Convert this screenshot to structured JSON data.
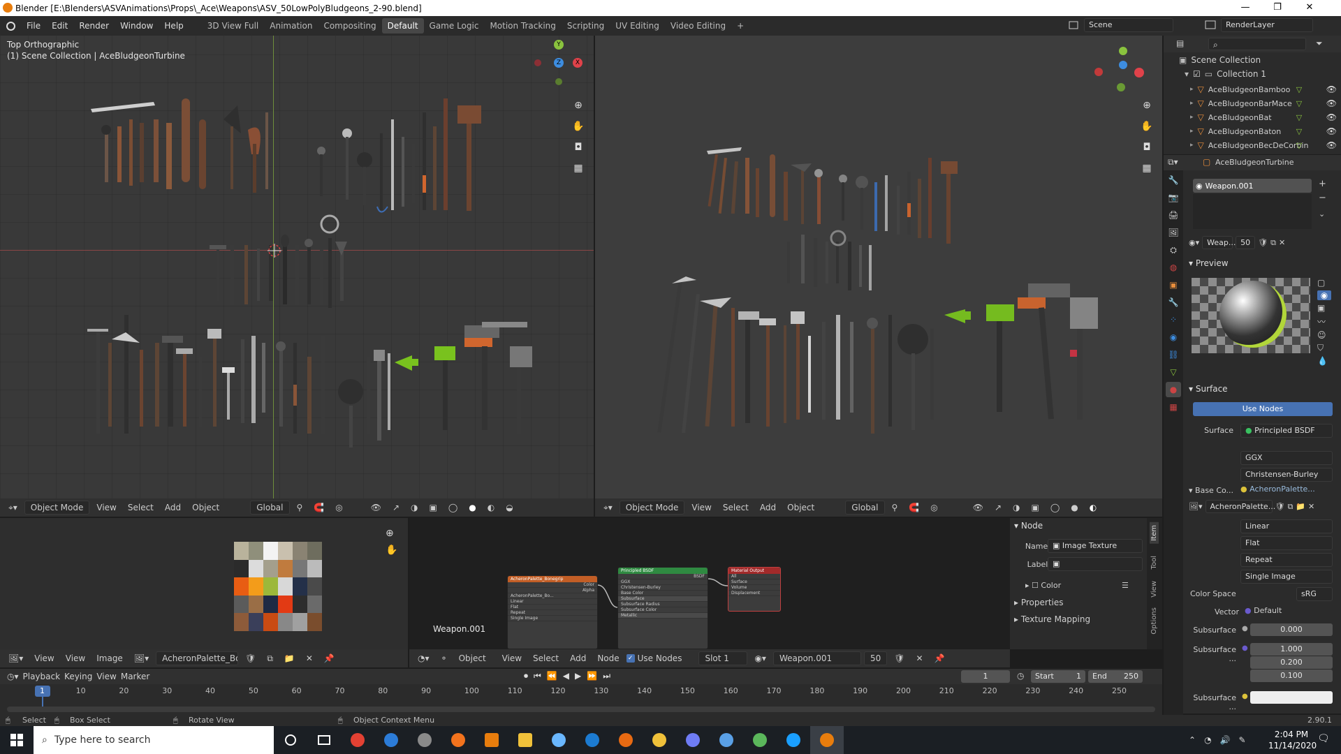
{
  "window": {
    "title": "Blender [E:\\Blenders\\ASVAnimations\\Props\\_Ace\\Weapons\\ASV_50LowPolyBludgeons_2-90.blend]",
    "min": "—",
    "max": "❐",
    "close": "✕"
  },
  "menu": [
    "File",
    "Edit",
    "Render",
    "Window",
    "Help"
  ],
  "workspaces": [
    "3D View Full",
    "Animation",
    "Compositing",
    "Default",
    "Game Logic",
    "Motion Tracking",
    "Scripting",
    "UV Editing",
    "Video Editing"
  ],
  "workspace_active": "Default",
  "workspace_add": "+",
  "scene": "Scene",
  "render_layer": "RenderLayer",
  "viewport_left": {
    "view_name": "Top Orthographic",
    "collection_info": "(1) Scene Collection | AceBludgeonTurbine",
    "mode": "Object Mode",
    "menus": [
      "View",
      "Select",
      "Add",
      "Object"
    ],
    "orientation": "Global"
  },
  "viewport_right": {
    "mode": "Object Mode",
    "menus": [
      "View",
      "Select",
      "Add",
      "Object"
    ],
    "orientation": "Global"
  },
  "gizmo": {
    "x": "X",
    "y": "Y",
    "z": "Z"
  },
  "outliner": {
    "root": "Scene Collection",
    "collection": "Collection 1",
    "items": [
      "AceBludgeonBamboo",
      "AceBludgeonBarMace",
      "AceBludgeonBat",
      "AceBludgeonBaton",
      "AceBludgeonBecDeCorbin"
    ],
    "search_placeholder": ""
  },
  "properties": {
    "object_name": "AceBludgeonTurbine",
    "material_slot": "Weapon.001",
    "material_short": "Weap...",
    "users": "50",
    "preview_label": "Preview",
    "surface_label": "Surface",
    "use_nodes": "Use Nodes",
    "surface_field_label": "Surface",
    "surface_value": "Principled BSDF",
    "distribution": "GGX",
    "subsurface_method": "Christensen-Burley",
    "base_color_label": "Base Co...",
    "base_color_value": "AcheronPalette...",
    "image_name": "AcheronPalette...",
    "interpolation": "Linear",
    "projection": "Flat",
    "extension": "Repeat",
    "source": "Single Image",
    "color_space_label": "Color Space",
    "color_space_value": "sRG",
    "vector_label": "Vector",
    "vector_value": "Default",
    "subsurface_label": "Subsurface",
    "subsurface_value": "0.000",
    "subsurface_radius_label": "Subsurface ...",
    "subsurface_radius": [
      "1.000",
      "0.200",
      "0.100"
    ],
    "subsurface_color_label": "Subsurface ..."
  },
  "image_editor": {
    "menus": [
      "View",
      "View",
      "Image"
    ],
    "image_name": "AcheronPalette_Bon...",
    "palette_colors": [
      "#b9b39c",
      "#8f8f7b",
      "#f3f3f3",
      "#c9c0ae",
      "#8a8373",
      "#6e6d5e",
      "#2b2b2b",
      "#dcdcdc",
      "#a49f8c",
      "#c07b3e",
      "#777777",
      "#bbbbbb",
      "#e85d13",
      "#f39c1a",
      "#9cb83a",
      "#d8d8d8",
      "#243049",
      "#4a4a4a",
      "#5b5b5b",
      "#9a6e46",
      "#1f2a44",
      "#e23a14",
      "#2d2d2d",
      "#6a6a6a",
      "#8d5b3a",
      "#3a3f5a",
      "#c94b13",
      "#888888",
      "#a0a0a0",
      "#7a4d2d"
    ]
  },
  "node_editor": {
    "object_menu": "Object",
    "menus": [
      "View",
      "Select",
      "Add",
      "Node"
    ],
    "use_nodes": "Use Nodes",
    "slot": "Slot 1",
    "material": "Weapon.001",
    "users": "50",
    "material_caption": "Weapon.001",
    "nodes": {
      "texture": {
        "title": "AcheronPalette_Bonegrip",
        "rows": [
          "Color",
          "Alpha",
          "AcheronPalette_Bo...",
          "Linear",
          "Flat",
          "Repeat",
          "Single Image"
        ]
      },
      "bsdf": {
        "title": "Principled BSDF",
        "rows": [
          "BSDF",
          "GGX",
          "Christensen-Burley",
          "Base Color",
          "Subsurface",
          "Subsurface Radius",
          "Subsurface Color",
          "Metallic"
        ]
      },
      "output": {
        "title": "Material Output",
        "rows": [
          "All",
          "Surface",
          "Volume",
          "Displacement"
        ]
      }
    }
  },
  "node_panel": {
    "section": "Node",
    "name_label": "Name:",
    "name_value": "Image Texture",
    "label_label": "Label:",
    "label_value": "",
    "color": "Color",
    "properties": "Properties",
    "texture_mapping": "Texture Mapping",
    "tabs": [
      "Item",
      "Tool",
      "View",
      "Options"
    ]
  },
  "timeline": {
    "menus": [
      "Playback",
      "Keying",
      "View",
      "Marker"
    ],
    "current_frame": "1",
    "start_label": "Start",
    "start": "1",
    "end_label": "End",
    "end": "250",
    "ticks": [
      "1",
      "10",
      "20",
      "30",
      "40",
      "50",
      "60",
      "70",
      "80",
      "90",
      "100",
      "110",
      "120",
      "130",
      "140",
      "150",
      "160",
      "170",
      "180",
      "190",
      "200",
      "210",
      "220",
      "230",
      "240",
      "250"
    ]
  },
  "statusbar": {
    "select": "Select",
    "box_select": "Box Select",
    "rotate": "Rotate View",
    "context_menu": "Object Context Menu",
    "version": "2.90.1"
  },
  "taskbar": {
    "search_placeholder": "Type here to search",
    "time": "2:04 PM",
    "date": "11/14/2020",
    "icons": [
      "cortana-icon",
      "task-view-icon",
      "chrome-icon",
      "mail-icon",
      "app-icon",
      "firefox-icon",
      "blender-icon",
      "file-explorer-icon",
      "notepad-icon",
      "calculator-icon",
      "app-w-icon",
      "app-pen-icon",
      "discord-icon",
      "app-robot-icon",
      "app-green-icon",
      "steam-icon",
      "blender-active-icon"
    ]
  },
  "colors": {
    "accent": "#4772b3",
    "x_axis": "#e0424a",
    "y_axis": "#8ac33e",
    "z_axis": "#3d8de0",
    "node_texture_header": "#c25e26",
    "node_bsdf_header": "#2f8a41",
    "node_output_header": "#a22a2a"
  }
}
